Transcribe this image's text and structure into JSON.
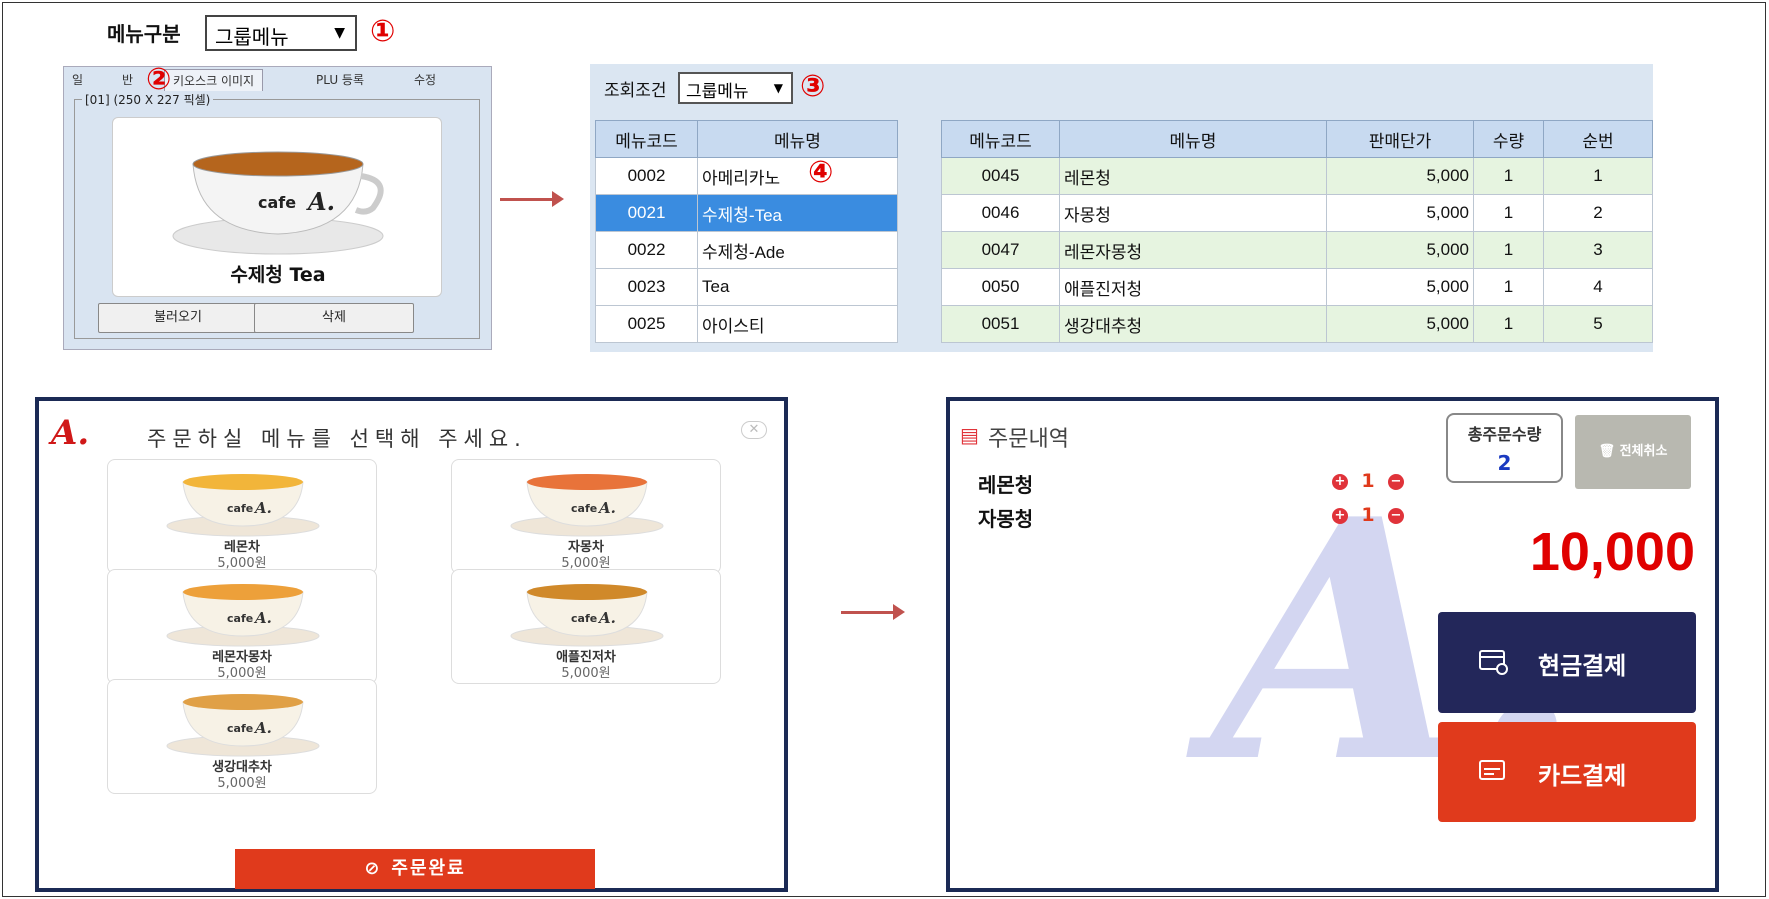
{
  "markers": {
    "m1": "①",
    "m2": "②",
    "m3": "③",
    "m4": "④"
  },
  "top": {
    "menu_div_label": "메뉴구분",
    "menu_div_value": "그룹메뉴"
  },
  "kiosk_editor": {
    "tabs": [
      "일",
      "반",
      "키오스크 이미지",
      "PLU 등록",
      "수정"
    ],
    "group_title": "[01] (250 X 227 픽셀)",
    "image_caption": "수제청 Tea",
    "load_button": "불러오기",
    "delete_button": "삭제"
  },
  "query": {
    "label": "조회조건",
    "value": "그룹메뉴",
    "left_headers": [
      "메뉴코드",
      "메뉴명"
    ],
    "left_rows": [
      {
        "code": "0002",
        "name": "아메리카노"
      },
      {
        "code": "0021",
        "name": "수제청-Tea"
      },
      {
        "code": "0022",
        "name": "수제청-Ade"
      },
      {
        "code": "0023",
        "name": "Tea"
      },
      {
        "code": "0025",
        "name": "아이스티"
      }
    ],
    "selected_index": 1,
    "right_headers": [
      "메뉴코드",
      "메뉴명",
      "판매단가",
      "수량",
      "순번"
    ],
    "right_rows": [
      {
        "code": "0045",
        "name": "레몬청",
        "price": "5,000",
        "qty": "1",
        "seq": "1"
      },
      {
        "code": "0046",
        "name": "자몽청",
        "price": "5,000",
        "qty": "1",
        "seq": "2"
      },
      {
        "code": "0047",
        "name": "레몬자몽청",
        "price": "5,000",
        "qty": "1",
        "seq": "3"
      },
      {
        "code": "0050",
        "name": "애플진저청",
        "price": "5,000",
        "qty": "1",
        "seq": "4"
      },
      {
        "code": "0051",
        "name": "생강대추청",
        "price": "5,000",
        "qty": "1",
        "seq": "5"
      }
    ]
  },
  "kiosk_menu": {
    "title": "주문하실 메뉴를 선택해 주세요.",
    "items": [
      {
        "name": "레몬차",
        "price": "5,000원"
      },
      {
        "name": "자몽차",
        "price": "5,000원"
      },
      {
        "name": "레몬자몽차",
        "price": "5,000원"
      },
      {
        "name": "애플진저차",
        "price": "5,000원"
      },
      {
        "name": "생강대추차",
        "price": "5,000원"
      }
    ],
    "complete_button": "주문완료",
    "logo_text": "A."
  },
  "order": {
    "title": "주문내역",
    "lines": [
      {
        "name": "레몬청",
        "qty": "1"
      },
      {
        "name": "자몽청",
        "qty": "1"
      }
    ],
    "total_qty_label": "총주문수량",
    "total_qty": "2",
    "clear_all": "전체취소",
    "total_amount": "10,000",
    "cash_button": "현금결제",
    "card_button": "카드결제",
    "watermark": "A."
  },
  "colors": {
    "accent_red": "#e03a1c",
    "navy": "#23275a",
    "selected_row": "#3a8ce0"
  }
}
